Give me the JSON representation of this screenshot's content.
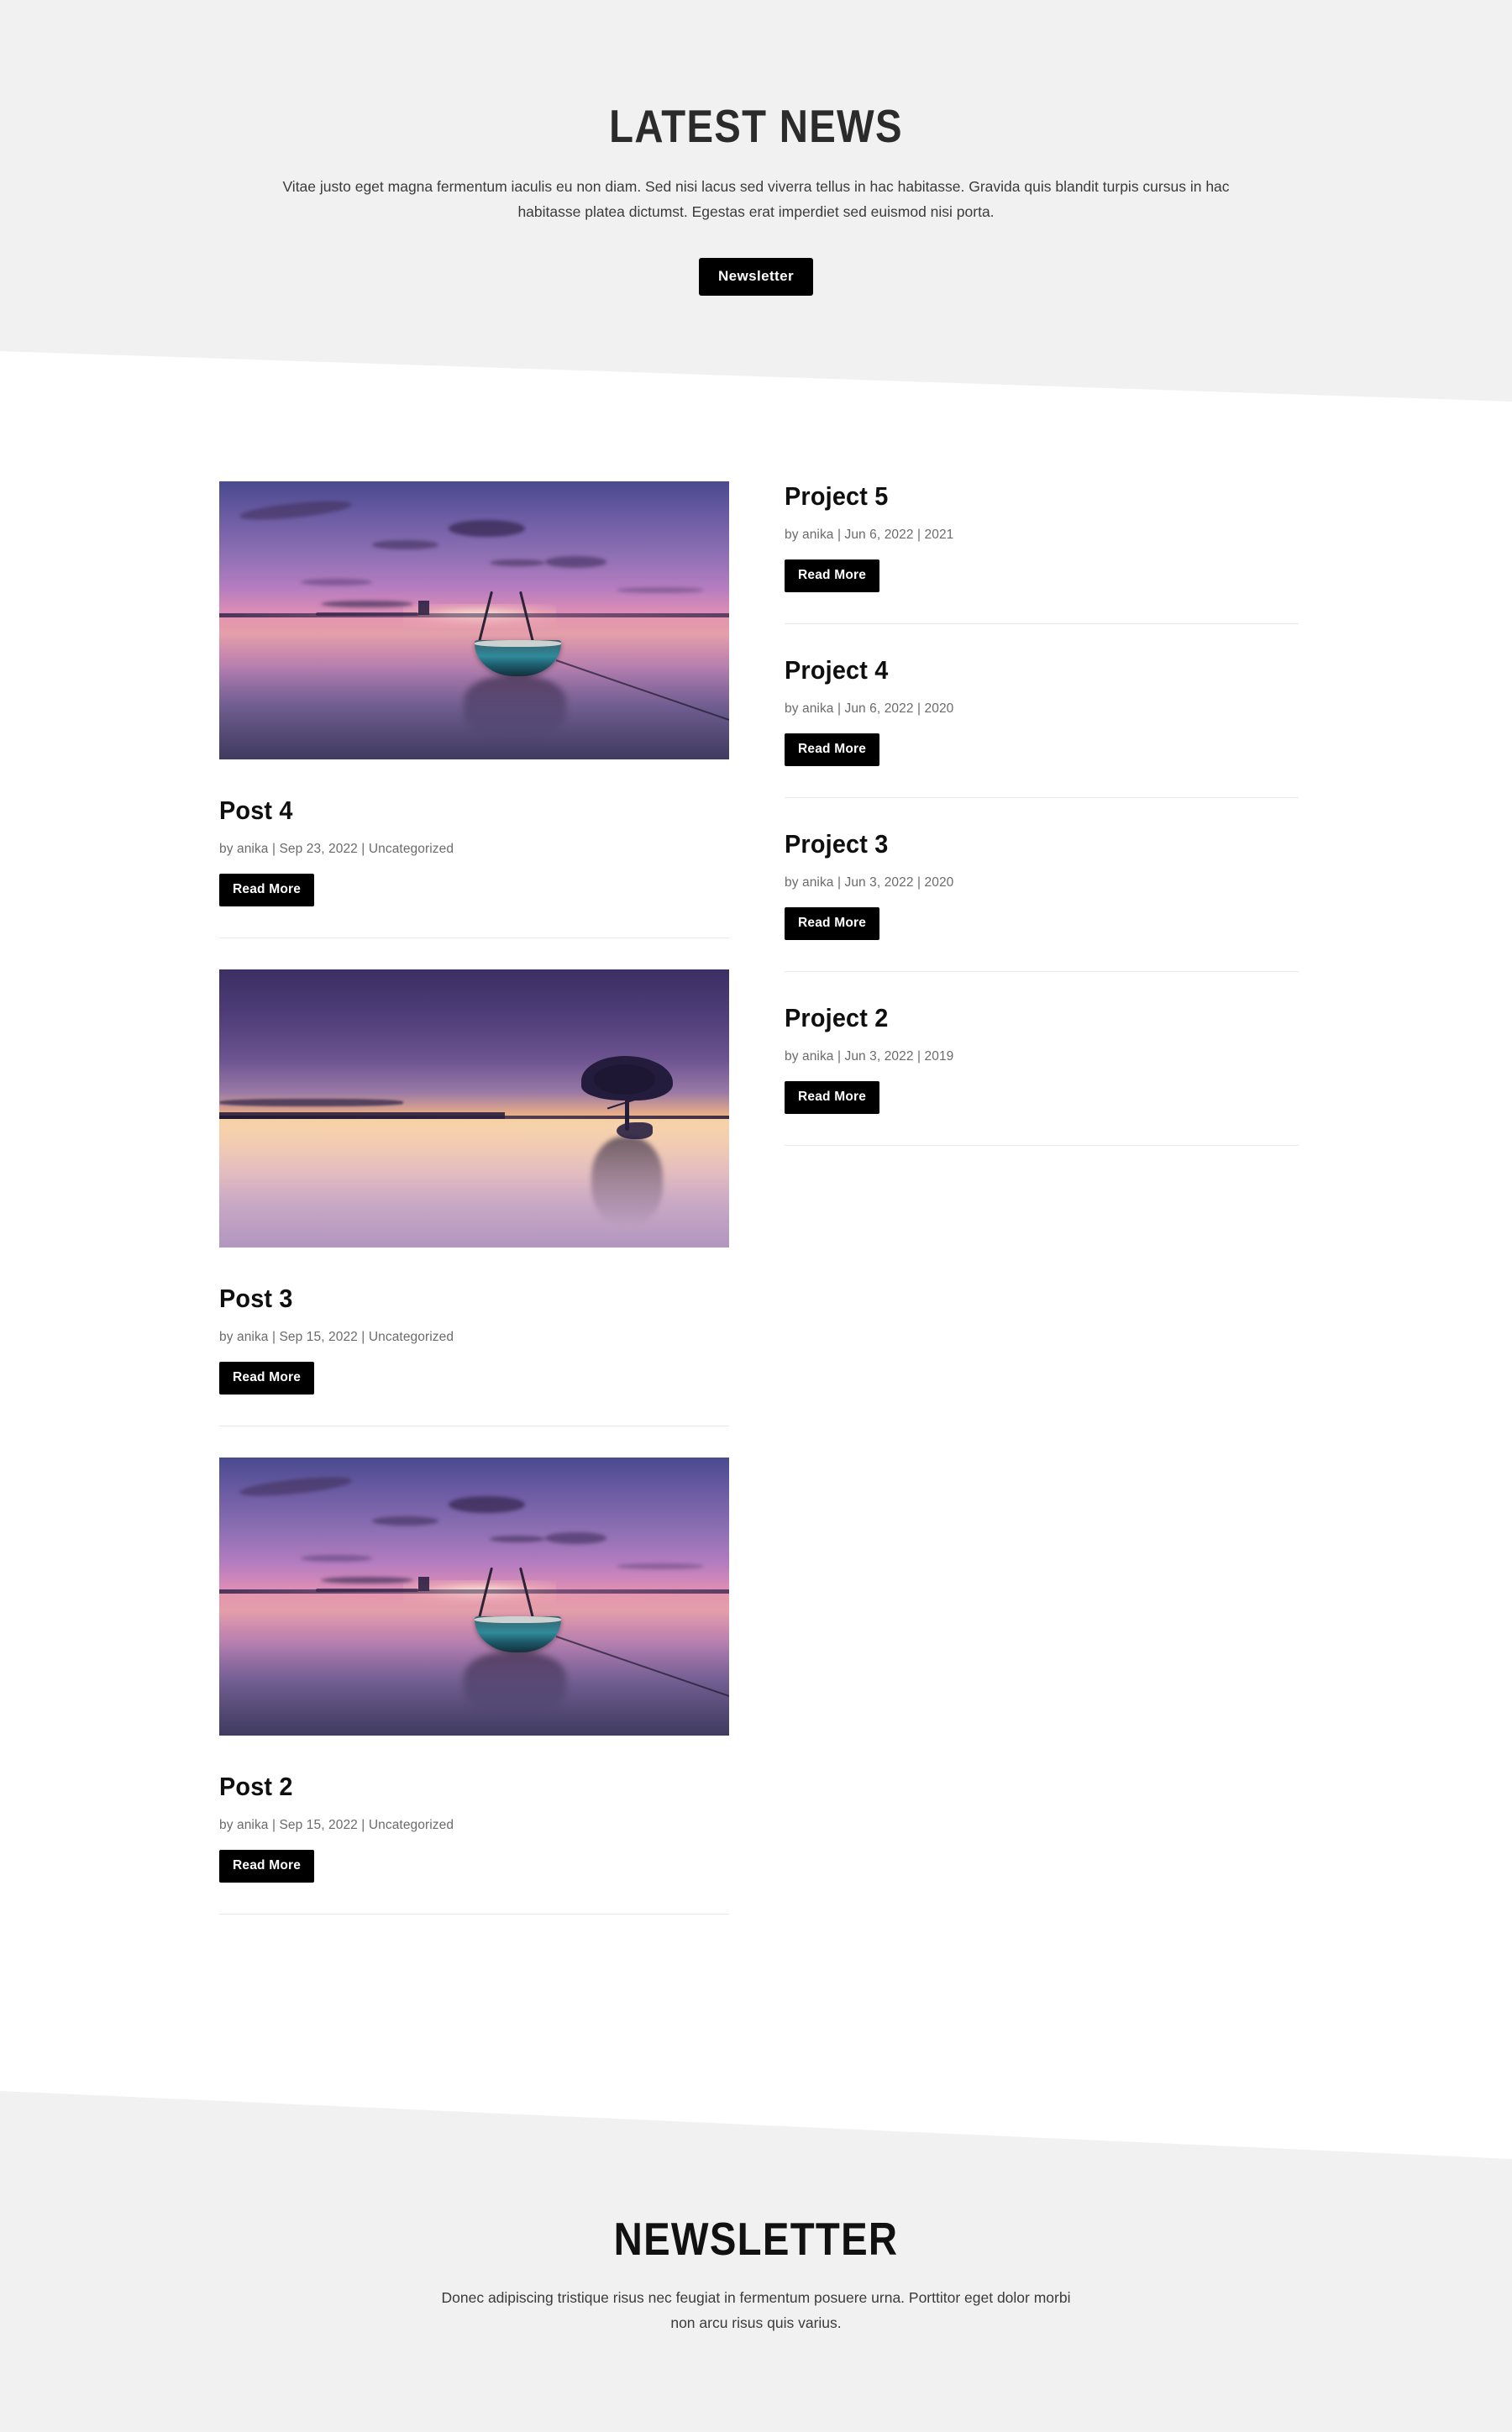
{
  "hero": {
    "title": "LATEST NEWS",
    "subtitle": "Vitae justo eget magna fermentum iaculis eu non diam. Sed nisi lacus sed viverra tellus in hac habitasse. Gravida quis blandit turpis cursus in hac habitasse platea dictumst. Egestas erat imperdiet sed euismod nisi porta.",
    "button_label": "Newsletter"
  },
  "posts": [
    {
      "title": "Post 4",
      "meta": "by anika | Sep 23, 2022 | Uncategorized",
      "button_label": "Read More",
      "image_name": "boat-sunset-photo"
    },
    {
      "title": "Post 3",
      "meta": "by anika | Sep 15, 2022 | Uncategorized",
      "button_label": "Read More",
      "image_name": "lone-tree-dusk-photo"
    },
    {
      "title": "Post 2",
      "meta": "by anika | Sep 15, 2022 | Uncategorized",
      "button_label": "Read More",
      "image_name": "boat-sunset-photo"
    }
  ],
  "projects": [
    {
      "title": "Project 5",
      "meta": "by anika | Jun 6, 2022 | 2021",
      "button_label": "Read More"
    },
    {
      "title": "Project 4",
      "meta": "by anika | Jun 6, 2022 | 2020",
      "button_label": "Read More"
    },
    {
      "title": "Project 3",
      "meta": "by anika | Jun 3, 2022 | 2020",
      "button_label": "Read More"
    },
    {
      "title": "Project 2",
      "meta": "by anika | Jun 3, 2022 | 2019",
      "button_label": "Read More"
    }
  ],
  "footer": {
    "title": "NEWSLETTER",
    "subtitle": "Donec adipiscing tristique risus nec feugiat in fermentum posuere urna. Porttitor eget dolor morbi non arcu risus quis varius."
  },
  "colors": {
    "band_background": "#f1f1f1",
    "page_background": "#ffffff",
    "button_background": "#000000",
    "button_text": "#ffffff",
    "heading_text": "#0f0f0f",
    "meta_text": "#6b6b6b",
    "divider": "#e8e8e8"
  }
}
